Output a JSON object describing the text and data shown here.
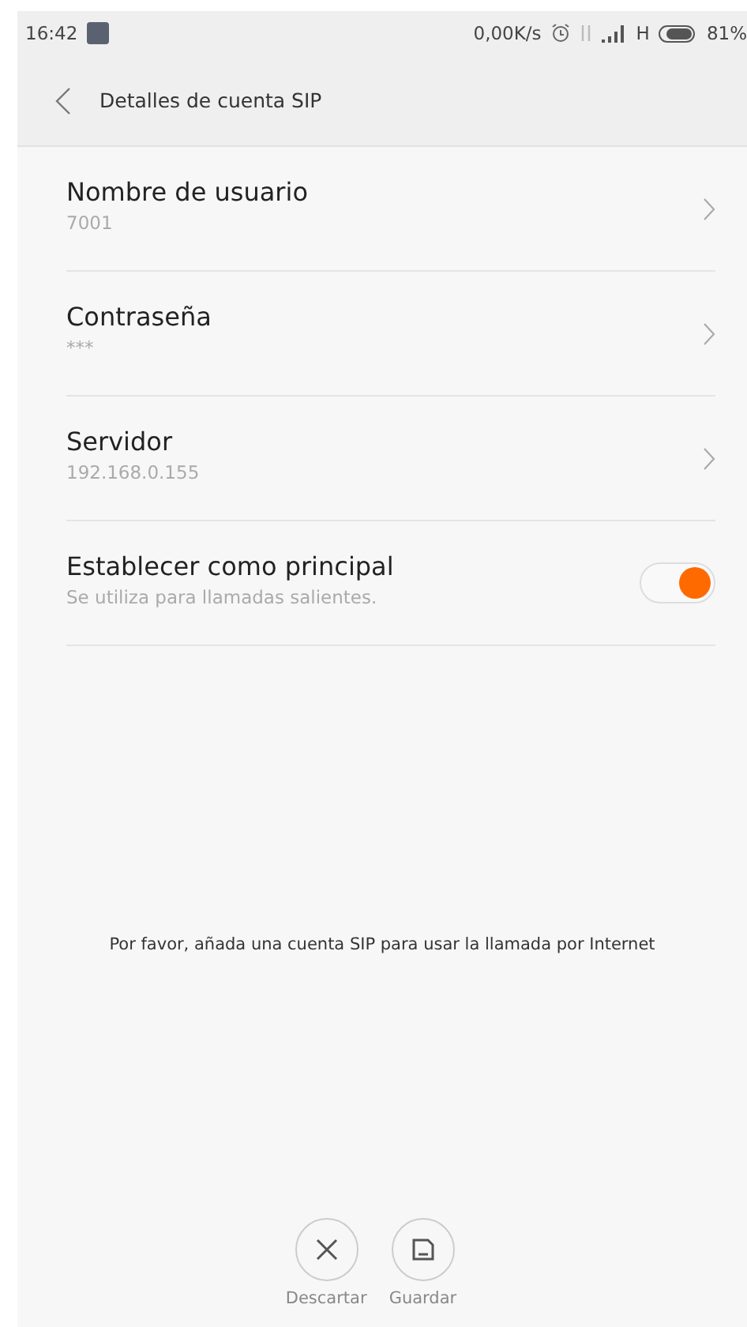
{
  "status_bar": {
    "time": "16:42",
    "speed": "0,00K/s",
    "network": "H",
    "battery": "81%"
  },
  "header": {
    "title": "Detalles de cuenta SIP"
  },
  "settings": [
    {
      "kind": "link",
      "title": "Nombre de usuario",
      "value": "7001"
    },
    {
      "kind": "link",
      "title": "Contraseña",
      "value": "***"
    },
    {
      "kind": "link",
      "title": "Servidor",
      "value": "192.168.0.155"
    },
    {
      "kind": "toggle",
      "title": "Establecer como principal",
      "value": "Se utiliza para llamadas salientes.",
      "on": true
    }
  ],
  "message": "Por favor, añada una cuenta SIP para usar la llamada por Internet",
  "actions": [
    {
      "kind": "discard",
      "label": "Descartar"
    },
    {
      "kind": "save",
      "label": "Guardar"
    }
  ]
}
